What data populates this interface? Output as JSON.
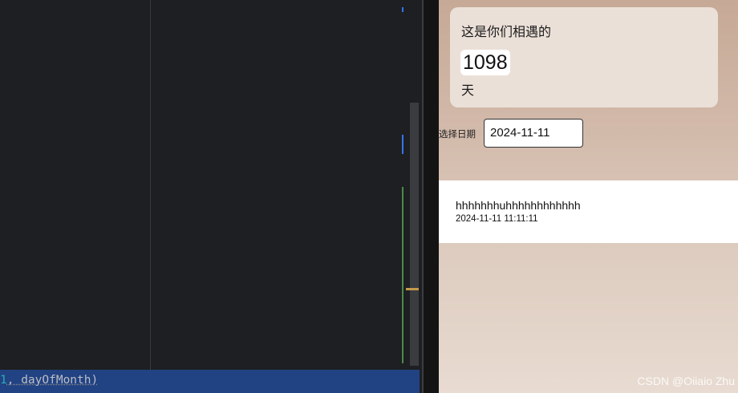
{
  "editor": {
    "code_line": {
      "number_fragment": "1",
      "rest": ", dayOfMonth)"
    }
  },
  "app": {
    "card": {
      "title": "这是你们相遇的",
      "days": "1098",
      "unit": "天"
    },
    "date_picker": {
      "label": "选择日期",
      "value": "2024-11-11"
    },
    "records": [
      {
        "title": "hhhhhhhuhhhhhhhhhhhh",
        "time": "2024-11-11 11:11:11"
      }
    ]
  },
  "watermark": "CSDN @Oiiaio Zhu"
}
